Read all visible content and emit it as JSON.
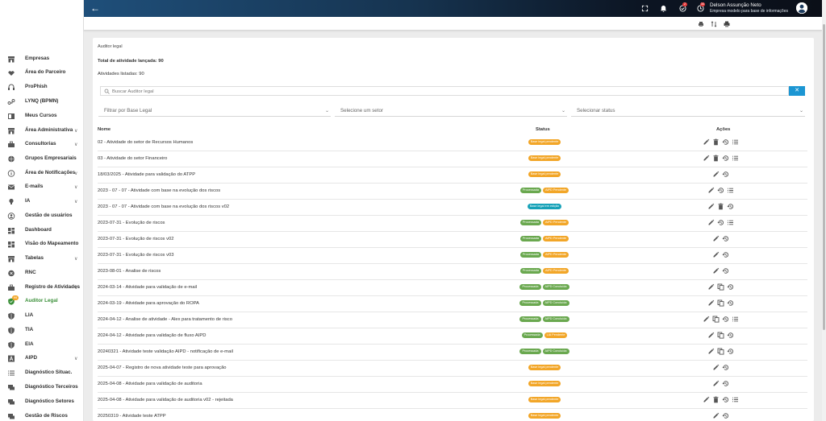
{
  "header": {
    "user_name": "Delson Assunção Neto",
    "company": "Empresa modelo para base de informações",
    "tasks_badge": "2",
    "alerts_badge": "34"
  },
  "sidebar": {
    "items": [
      {
        "label": "Empresas",
        "icon": "store-icon",
        "chevron": false,
        "active": false
      },
      {
        "label": "Área do Parceiro",
        "icon": "handshake-icon",
        "chevron": false,
        "active": false
      },
      {
        "label": "ProPhish",
        "icon": "headset-icon",
        "chevron": false,
        "active": false
      },
      {
        "label": "LYNQ (BPMN)",
        "icon": "flow-icon",
        "chevron": false,
        "active": false
      },
      {
        "label": "Meus Cursos",
        "icon": "book-icon",
        "chevron": false,
        "active": false
      },
      {
        "label": "Área Administrativa",
        "icon": "store-icon",
        "chevron": true,
        "active": false
      },
      {
        "label": "Consultorias",
        "icon": "briefcase-icon",
        "chevron": true,
        "active": false
      },
      {
        "label": "Grupos Empresariais",
        "icon": "globe-icon",
        "chevron": false,
        "active": false
      },
      {
        "label": "Área de Notificações",
        "icon": "info-icon",
        "chevron": true,
        "active": false
      },
      {
        "label": "E-mails",
        "icon": "mail-icon",
        "chevron": true,
        "active": false
      },
      {
        "label": "IA",
        "icon": "bulb-icon",
        "chevron": true,
        "active": false
      },
      {
        "label": "Gestão de usuários",
        "icon": "user-icon",
        "chevron": false,
        "active": false
      },
      {
        "label": "Dashboard",
        "icon": "dashboard-icon",
        "chevron": false,
        "active": false
      },
      {
        "label": "Visão do Mapeamento",
        "icon": "dashboard-icon",
        "chevron": false,
        "active": false
      },
      {
        "label": "Tabelas",
        "icon": "store-icon",
        "chevron": true,
        "active": false
      },
      {
        "label": "RNC",
        "icon": "close-circle-icon",
        "chevron": false,
        "active": false
      },
      {
        "label": "Registro de Atividades",
        "icon": "briefcase-icon",
        "chevron": true,
        "active": false
      },
      {
        "label": "Auditor Legal",
        "icon": "shield-check-icon",
        "chevron": false,
        "active": true,
        "badge": "99"
      },
      {
        "label": "LIA",
        "icon": "shield-icon",
        "chevron": false,
        "active": false
      },
      {
        "label": "TIA",
        "icon": "shield-icon",
        "chevron": false,
        "active": false
      },
      {
        "label": "EIA",
        "icon": "shield-icon",
        "chevron": false,
        "active": false
      },
      {
        "label": "AIPD",
        "icon": "font-icon",
        "chevron": true,
        "active": false
      },
      {
        "label": "Diagnóstico Situac.",
        "icon": "list-icon",
        "chevron": false,
        "active": false
      },
      {
        "label": "Diagnóstico Terceiros",
        "icon": "chat-icon",
        "chevron": false,
        "active": false
      },
      {
        "label": "Diagnóstico Setores",
        "icon": "chat-icon",
        "chevron": false,
        "active": false
      },
      {
        "label": "Gestão de Riscos",
        "icon": "chat-icon",
        "chevron": false,
        "active": false
      }
    ]
  },
  "page": {
    "breadcrumb": "Auditor legal",
    "total_label": "Total de atividade lançada: 90",
    "listed_label": "Atividades listadas: 90",
    "search_placeholder": "Buscar Auditor legal",
    "clear_button": "✕",
    "filters": [
      "Filtrar por Base Legal",
      "Selecione um setor",
      "Selecionar status"
    ],
    "columns": {
      "name": "Nome",
      "status": "Status",
      "actions": "Ações"
    }
  },
  "colors": {
    "orange": "#f2a628",
    "green": "#6aa84f",
    "teal": "#17a2b8",
    "active": "#3a8f38"
  },
  "rows": [
    {
      "name": "02 - Atividade do setor de Recursos Humanos",
      "status": [
        [
          "Base legal pendente",
          "orange"
        ]
      ],
      "actions": [
        "edit",
        "delete",
        "history",
        "list"
      ]
    },
    {
      "name": "03 - Atividade do setor Financeiro",
      "status": [
        [
          "Base legal pendente",
          "orange"
        ]
      ],
      "actions": [
        "edit",
        "delete",
        "history",
        "list"
      ]
    },
    {
      "name": "18/03/2025 - Atividade para validação do ATPP",
      "status": [
        [
          "Base legal pendente",
          "orange"
        ]
      ],
      "actions": [
        "edit",
        "history"
      ]
    },
    {
      "name": "2023 - 07 - 07 - Atividade com base na evolução dos riscos",
      "status": [
        [
          "Processada",
          "green"
        ],
        [
          "AIPD Pendente",
          "orange"
        ]
      ],
      "actions": [
        "edit",
        "history",
        "list"
      ]
    },
    {
      "name": "2023 - 07 - 07 - Atividade com base na evolução dos riscos v02",
      "status": [
        [
          "Base legal em edição",
          "teal"
        ]
      ],
      "actions": [
        "edit",
        "delete",
        "history"
      ]
    },
    {
      "name": "2023-07-31 - Evolução de riscos",
      "status": [
        [
          "Processada",
          "green"
        ],
        [
          "AIPD Pendente",
          "orange"
        ]
      ],
      "actions": [
        "edit",
        "history",
        "list"
      ]
    },
    {
      "name": "2023-07-31 - Evolução de riscos v02",
      "status": [
        [
          "Processada",
          "green"
        ],
        [
          "AIPD Pendente",
          "orange"
        ]
      ],
      "actions": [
        "edit",
        "history"
      ]
    },
    {
      "name": "2023-07-31 - Evolução de riscos v03",
      "status": [
        [
          "Processada",
          "green"
        ],
        [
          "AIPD Pendente",
          "orange"
        ]
      ],
      "actions": [
        "edit",
        "history"
      ]
    },
    {
      "name": "2023-08-01 - Analise de riscos",
      "status": [
        [
          "Processada",
          "green"
        ],
        [
          "AIPD Pendente",
          "orange"
        ]
      ],
      "actions": [
        "edit",
        "history"
      ]
    },
    {
      "name": "2024-03-14 - Atividade para validação de e-mail",
      "status": [
        [
          "Processada",
          "green"
        ],
        [
          "AIPD Concluída",
          "green"
        ]
      ],
      "actions": [
        "edit",
        "copy",
        "history"
      ]
    },
    {
      "name": "2024-03-19 - Atividade para aprovação do ROPA",
      "status": [
        [
          "Processada",
          "green"
        ],
        [
          "AIPD Concluída",
          "green"
        ]
      ],
      "actions": [
        "edit",
        "copy",
        "history"
      ]
    },
    {
      "name": "2024-04-12 - Analise de atividade - Alex para tratamento de risco",
      "status": [
        [
          "Processada",
          "green"
        ],
        [
          "AIPD Concluída",
          "green"
        ]
      ],
      "actions": [
        "edit",
        "copy",
        "history",
        "list"
      ]
    },
    {
      "name": "2024-04-12 - Atividade para validação de fluxo AIPD",
      "status": [
        [
          "Processada",
          "green"
        ],
        [
          "LIA Pendente",
          "orange"
        ]
      ],
      "actions": [
        "edit",
        "copy",
        "history"
      ]
    },
    {
      "name": "20240321 - Atividade teste validação AIPD - notificação de e-mail",
      "status": [
        [
          "Processada",
          "green"
        ],
        [
          "AIPD Concluída",
          "green"
        ]
      ],
      "actions": [
        "edit",
        "copy",
        "history"
      ]
    },
    {
      "name": "2025-04-07 - Registro de nova atividade teste para aprovação",
      "status": [
        [
          "Base legal pendente",
          "orange"
        ]
      ],
      "actions": [
        "edit",
        "history"
      ]
    },
    {
      "name": "2025-04-08 - Atividade para validação de auditoria",
      "status": [
        [
          "Base legal pendente",
          "orange"
        ]
      ],
      "actions": [
        "edit",
        "history"
      ]
    },
    {
      "name": "2025-04-08 - Atividade para validação de auditoria v02 - rejeitada",
      "status": [
        [
          "Base legal pendente",
          "orange"
        ]
      ],
      "actions": [
        "edit",
        "delete",
        "history",
        "list"
      ]
    },
    {
      "name": "20250319 - Atividade teste ATPP",
      "status": [
        [
          "Base legal pendente",
          "orange"
        ]
      ],
      "actions": [
        "edit",
        "history"
      ]
    }
  ]
}
